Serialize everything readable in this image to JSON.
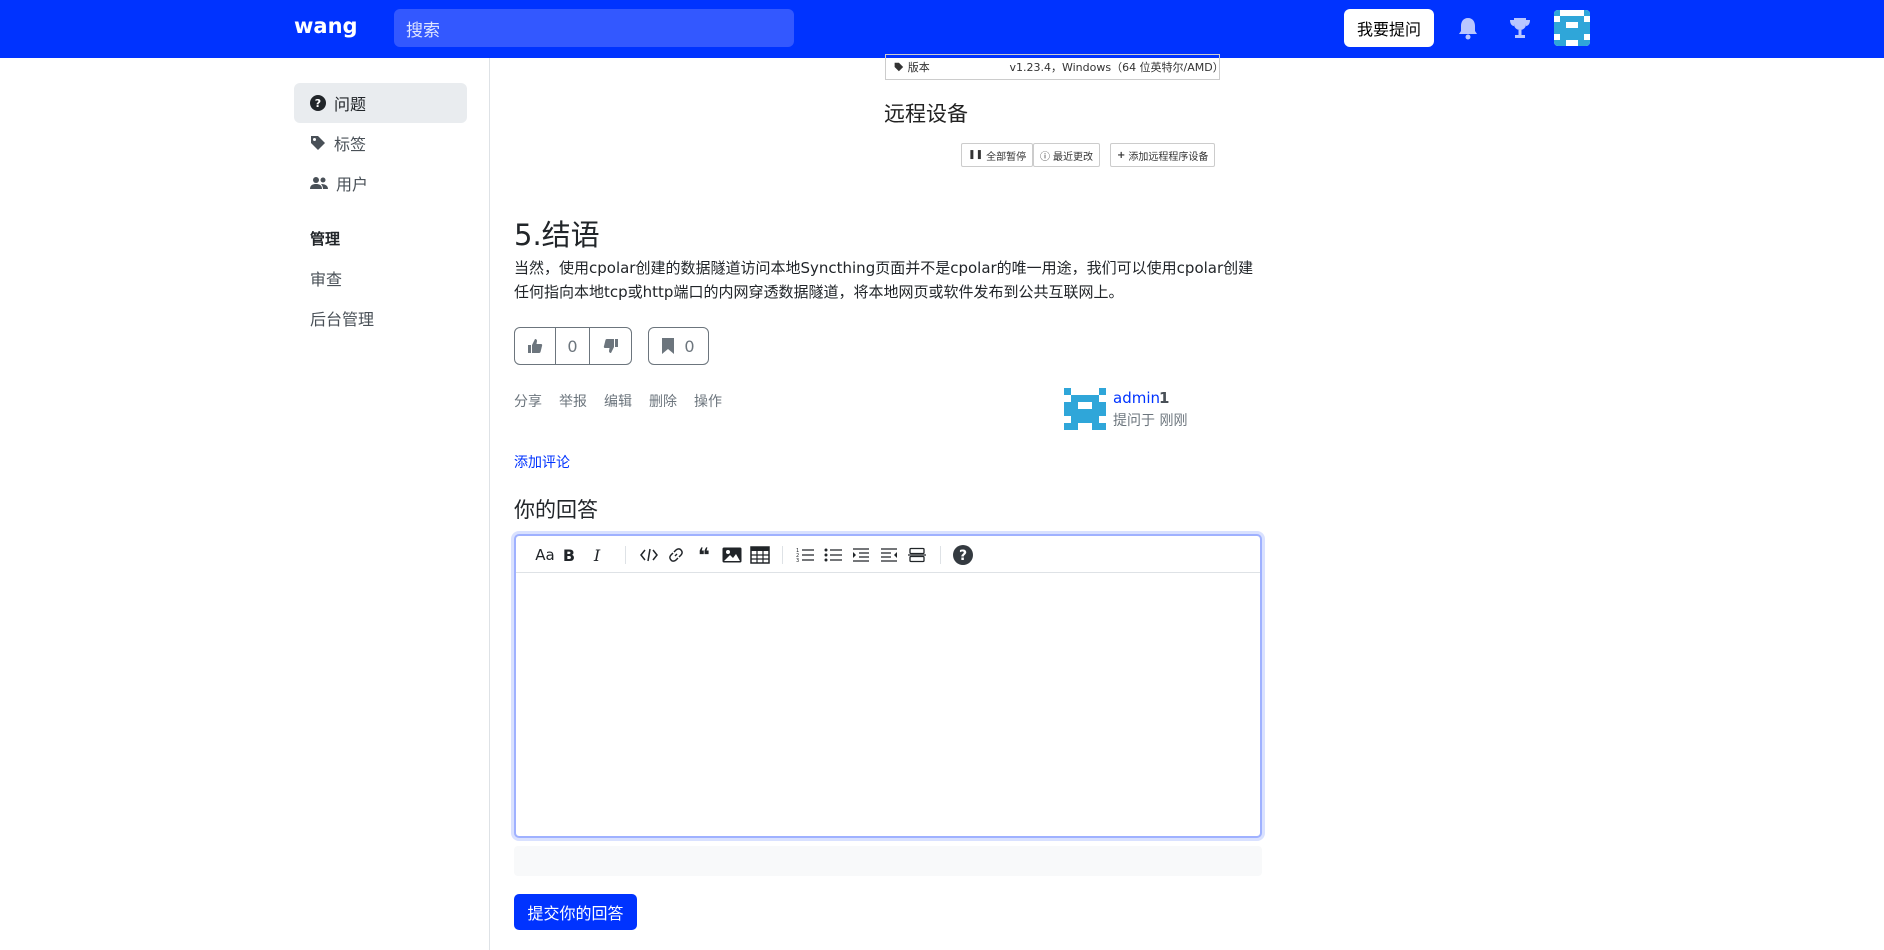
{
  "navbar": {
    "brand": "wang",
    "search_placeholder": "搜索",
    "ask_button": "我要提问"
  },
  "sidebar": {
    "items": [
      {
        "label": "问题",
        "icon": "question-circle-icon"
      },
      {
        "label": "标签",
        "icon": "tags-icon"
      },
      {
        "label": "用户",
        "icon": "people-icon"
      }
    ],
    "admin_heading": "管理",
    "admin_links": [
      "审查",
      "后台管理"
    ]
  },
  "content": {
    "image_fragment": {
      "key": "版本",
      "value": "v1.23.4，Windows（64 位英特尔/AMD）"
    },
    "remote_title": "远程设备",
    "remote_buttons": [
      "全部暂停",
      "最近更改",
      "添加远程程序设备"
    ],
    "conclusion_heading": "5.结语",
    "conclusion_paragraph": "当然，使用cpolar创建的数据隧道访问本地Syncthing页面并不是cpolar的唯一用途，我们可以使用cpolar创建任何指向本地tcp或http端口的内网穿透数据隧道，将本地网页或软件发布到公共互联网上。"
  },
  "votes": {
    "count": "0",
    "bookmarks": "0"
  },
  "actions": [
    "分享",
    "举报",
    "编辑",
    "删除",
    "操作"
  ],
  "author": {
    "name": "admin",
    "reputation": "1",
    "asked": "提问于 刚刚"
  },
  "add_comment": "添加评论",
  "answer": {
    "heading": "你的回答",
    "toolbar_heading_label": "Aa",
    "submit": "提交你的回答"
  },
  "colors": {
    "brand": "#0033ff"
  }
}
